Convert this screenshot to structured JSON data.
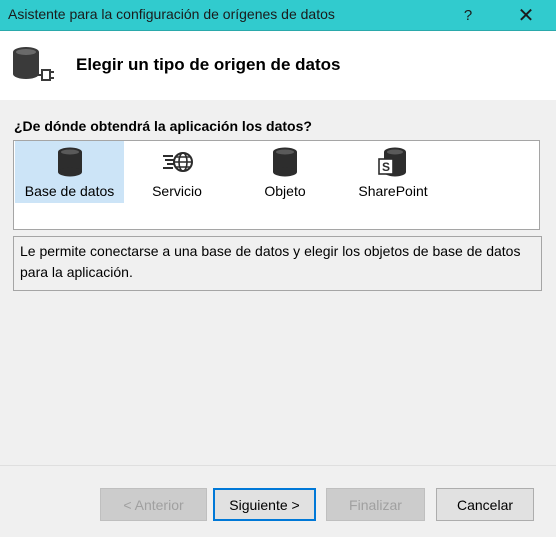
{
  "window": {
    "title": "Asistente para la configuración de orígenes de datos",
    "help_label": "?",
    "close_label": "✕"
  },
  "header": {
    "title": "Elegir un tipo de origen de datos",
    "icon": "database-plug-icon"
  },
  "question": "¿De dónde obtendrá la aplicación los datos?",
  "types": [
    {
      "label": "Base de datos",
      "icon": "database-icon",
      "selected": true
    },
    {
      "label": "Servicio",
      "icon": "service-icon",
      "selected": false
    },
    {
      "label": "Objeto",
      "icon": "object-icon",
      "selected": false
    },
    {
      "label": "SharePoint",
      "icon": "sharepoint-icon",
      "selected": false
    }
  ],
  "description": "Le permite conectarse a una base de datos y elegir los objetos de base de datos para la aplicación.",
  "buttons": {
    "previous": "< Anterior",
    "next": "Siguiente >",
    "finish": "Finalizar",
    "cancel": "Cancelar"
  },
  "colors": {
    "titlebar": "#31cbce",
    "selection": "#cce4f7",
    "default_button_border": "#0078d7"
  }
}
